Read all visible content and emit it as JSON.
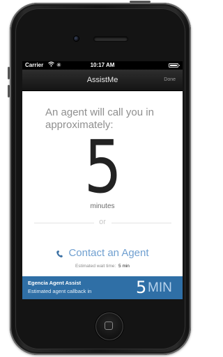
{
  "status_bar": {
    "carrier": "Carrier",
    "time": "10:17 AM"
  },
  "nav": {
    "title": "AssistMe",
    "done_label": "Done"
  },
  "main": {
    "headline": "An agent will call you in approximately:",
    "wait_number": "5",
    "wait_unit": "minutes",
    "or_label": "or",
    "contact_label": "Contact an Agent",
    "estimated_label": "Estimated wait time:",
    "estimated_value": "5 min"
  },
  "banner": {
    "title": "Egencia Agent Assist",
    "subtitle": "Estimated agent callback in",
    "number": "5",
    "unit": "MIN"
  },
  "colors": {
    "banner_bg": "#2f6fa6",
    "link_blue": "#6f9fd0",
    "nav_bg": "#1e1e1e"
  },
  "icons": [
    "wifi-icon",
    "activity-spinner-icon",
    "battery-icon",
    "phone-handset-icon",
    "home-button-icon"
  ]
}
